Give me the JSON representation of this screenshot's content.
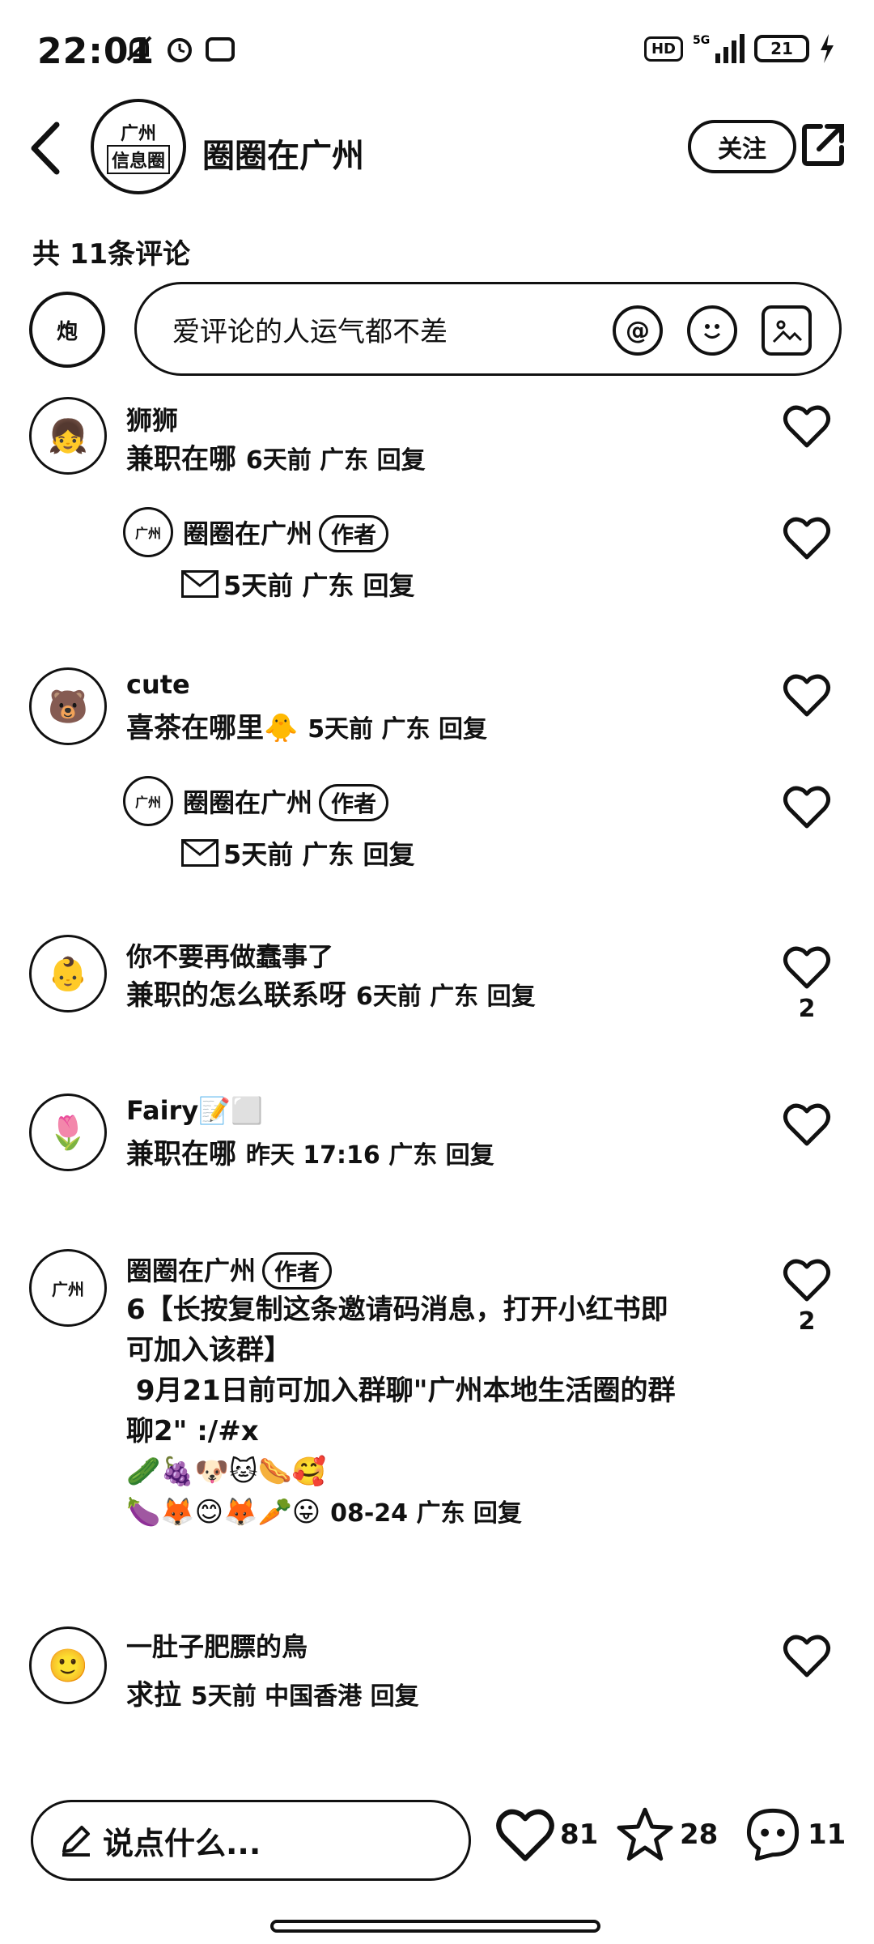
{
  "status_bar": {
    "time": "22:01",
    "hd_label": "HD",
    "network": "5G",
    "battery": "21"
  },
  "header": {
    "title": "圈圈在广州",
    "follow_label": "关注",
    "avatar_line1": "广州",
    "avatar_line2": "信息圈"
  },
  "comments_count": "共 11条评论",
  "input": {
    "placeholder": "爱评论的人运气都不差"
  },
  "comments": [
    {
      "name": "狮狮",
      "text": "兼职在哪",
      "meta": "6天前 广东 回复",
      "like_count": "",
      "reply": {
        "name": "圈圈在广州",
        "badge": "作者",
        "meta": "5天前 广东 回复"
      }
    },
    {
      "name": "cute",
      "text": "喜茶在哪里🐥",
      "meta": "5天前 广东 回复",
      "like_count": "",
      "reply": {
        "name": "圈圈在广州",
        "badge": "作者",
        "meta": "5天前 广东 回复"
      }
    },
    {
      "name": "你不要再做蠢事了",
      "text": "兼职的怎么联系呀",
      "meta": "6天前 广东 回复",
      "like_count": "2"
    },
    {
      "name": "Fairy📝⬜",
      "text": "兼职在哪",
      "meta": "昨天 17:16 广东 回复",
      "like_count": ""
    },
    {
      "name": "圈圈在广州",
      "badge": "作者",
      "text_lines": [
        "6【长按复制这条邀请码消息，打开小红书即",
        "可加入该群】",
        " 9月21日前可加入群聊\"广州本地生活圈的群",
        "聊2\" :/#x",
        "🥒🍇🐶🐱🌭🥰",
        "🍆🦊😊🦊🥕😛"
      ],
      "meta": "08-24 广东 回复",
      "like_count": "2"
    },
    {
      "name": "一肚子肥膘的鳥",
      "text": "求拉",
      "meta": "5天前 中国香港 回复",
      "like_count": ""
    }
  ],
  "bottom": {
    "say_placeholder": "说点什么...",
    "likes": "81",
    "stars": "28",
    "comments": "11"
  }
}
